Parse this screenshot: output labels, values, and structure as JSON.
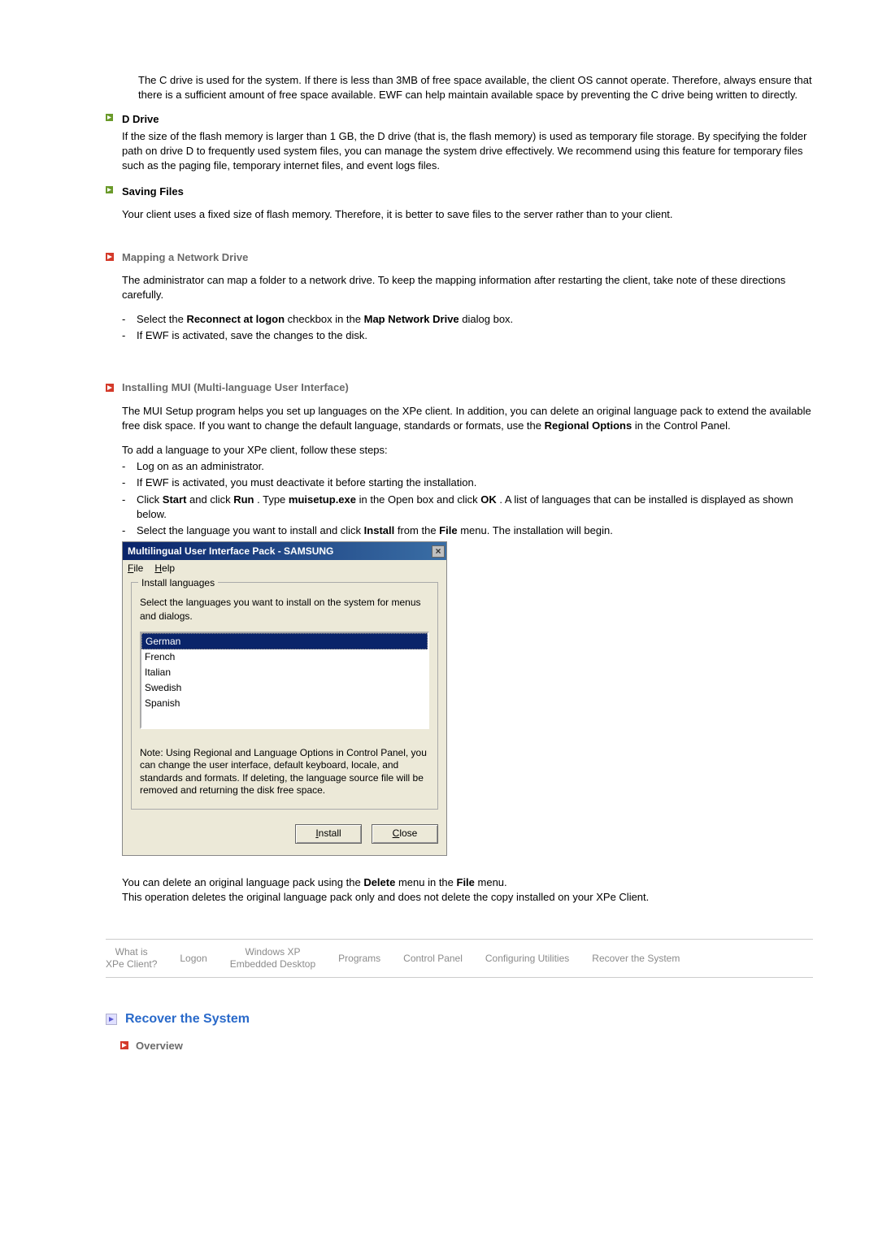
{
  "intro_c_drive": "The C drive is used for the system. If there is less than 3MB of free space available, the client OS cannot operate. Therefore, always ensure that there is a sufficient amount of free space available. EWF can help maintain available space by preventing the C drive being written to directly.",
  "d_drive": {
    "title": "D Drive",
    "text": "If the size of the flash memory is larger than 1 GB, the D drive (that is, the flash memory) is used as temporary file storage. By specifying the folder path on drive D to frequently used system files, you can manage the system drive effectively. We recommend using this feature for temporary files such as the paging file, temporary internet files, and event logs files."
  },
  "saving_files": {
    "title": "Saving Files",
    "text": "Your client uses a fixed size of flash memory. Therefore, it is better to save files to the server rather than to your client."
  },
  "mapping": {
    "title": "Mapping a Network Drive",
    "intro": "The administrator can map a folder to a network drive. To keep the mapping information after restarting the client, take note of these directions carefully.",
    "item1_pre": "Select the ",
    "item1_b1": "Reconnect at logon",
    "item1_mid": " checkbox in the ",
    "item1_b2": "Map Network Drive",
    "item1_post": " dialog box.",
    "item2": "If EWF is activated, save the changes to the disk."
  },
  "mui": {
    "title": "Installing MUI (Multi-language User Interface)",
    "p1_pre": "The MUI Setup program helps you set up languages on the XPe client. In addition, you can delete an original language pack to extend the available free disk space. If you want to change the default language, standards or formats, use the ",
    "p1_b": "Regional Options",
    "p1_post": " in the Control Panel.",
    "p2": "To add a language to your XPe client, follow these steps:",
    "li1": "Log on as an administrator.",
    "li2": "If EWF is activated, you must deactivate it before starting the installation.",
    "li3_a": "Click ",
    "li3_b1": "Start",
    "li3_b": " and click ",
    "li3_b2": "Run",
    "li3_c": " . Type ",
    "li3_b3": "muisetup.exe",
    "li3_d": " in the Open box and click ",
    "li3_b4": "OK",
    "li3_e": " . A list of languages that can be installed is displayed as shown below.",
    "li4_a": "Select the language you want to install and click ",
    "li4_b1": "Install",
    "li4_b": " from the ",
    "li4_b2": "File",
    "li4_c": " menu. The installation will begin."
  },
  "dialog": {
    "title": "Multilingual User Interface Pack - SAMSUNG",
    "menu_file": "File",
    "menu_help": "Help",
    "legend": "Install languages",
    "desc": "Select the languages you want to install on the system for menus and dialogs.",
    "langs": [
      "German",
      "French",
      "Italian",
      "Swedish",
      "Spanish"
    ],
    "note": "Note: Using Regional and Language Options in Control Panel, you can change the user interface, default keyboard, locale, and standards and formats. If deleting, the language source file will be removed and returning the disk free space.",
    "btn_install": "Install",
    "btn_close": "Close",
    "x": "×"
  },
  "after_dialog": {
    "l1_a": "You can delete an original language pack using the ",
    "l1_b1": "Delete",
    "l1_b": " menu in the ",
    "l1_b2": "File",
    "l1_c": " menu.",
    "l2": "This operation deletes the original language pack only and does not delete the copy installed on your XPe Client."
  },
  "tabs": [
    "What is\nXPe Client?",
    "Logon",
    "Windows XP\nEmbedded Desktop",
    "Programs",
    "Control Panel",
    "Configuring Utilities",
    "Recover the System"
  ],
  "recover": {
    "title": "Recover the System",
    "sub": "Overview"
  }
}
